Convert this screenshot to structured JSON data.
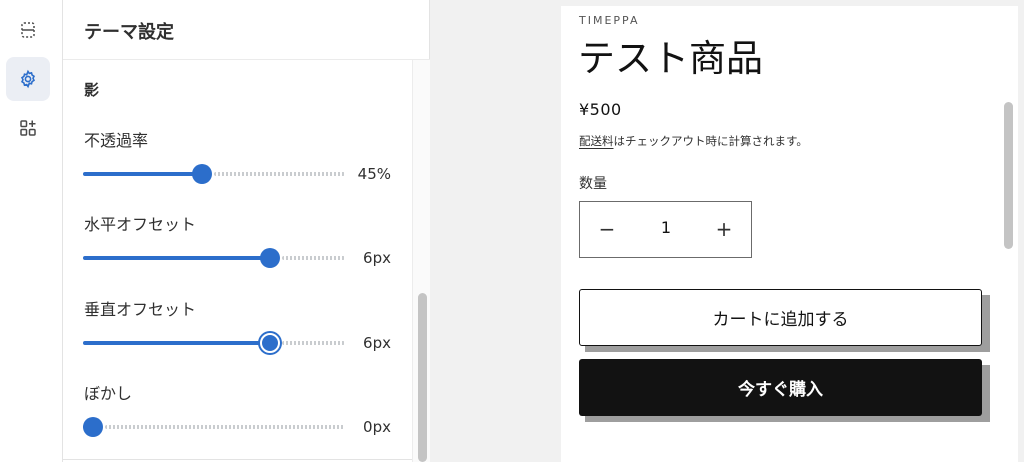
{
  "rail": {
    "items": [
      {
        "icon": "sections-icon",
        "active": false
      },
      {
        "icon": "gear-icon",
        "active": true
      },
      {
        "icon": "apps-add-icon",
        "active": false
      }
    ]
  },
  "panel": {
    "title": "テーマ設定",
    "section_title": "影",
    "settings": [
      {
        "label": "不透過率",
        "value": "45%",
        "fraction": 0.45
      },
      {
        "label": "水平オフセット",
        "value": "6px",
        "fraction": 0.73
      },
      {
        "label": "垂直オフセット",
        "value": "6px",
        "fraction": 0.73
      },
      {
        "label": "ぼかし",
        "value": "0px",
        "fraction": 0.0
      }
    ]
  },
  "preview": {
    "brand": "TIMEPPA",
    "product_title": "テスト商品",
    "price": "¥500",
    "shipping_link": "配送料",
    "shipping_text": "はチェックアウト時に計算されます。",
    "quantity_label": "数量",
    "quantity_value": "1",
    "minus_symbol": "−",
    "plus_symbol": "+",
    "add_to_cart": "カートに追加する",
    "buy_now": "今すぐ購入"
  },
  "colors": {
    "accent": "#2c6ecb",
    "buy_button": "#121212",
    "shadow": "#9e9e9e"
  }
}
